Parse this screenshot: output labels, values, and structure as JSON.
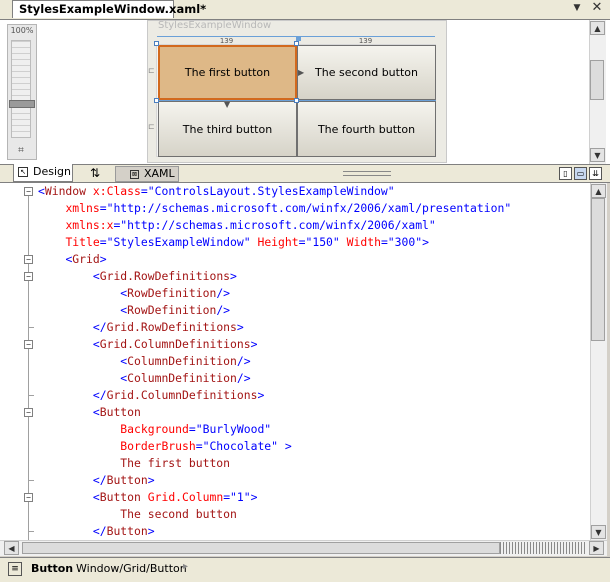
{
  "document_tab": {
    "title": "StylesExampleWindow.xaml*"
  },
  "tab_controls": {
    "menu_icon": "▼",
    "close_icon": "✕"
  },
  "design": {
    "zoom_label": "100%",
    "window_title": "StylesExampleWindow",
    "column_widths": [
      "139",
      "139"
    ],
    "row_marker_glyphs": [
      "⊏",
      "⊏"
    ],
    "buttons": [
      {
        "label": "The first button",
        "background": "#deb887",
        "border": "#d2691e",
        "selected": true
      },
      {
        "label": "The second button"
      },
      {
        "label": "The third button"
      },
      {
        "label": "The fourth button"
      }
    ]
  },
  "view_tabs": {
    "design_label": "Design",
    "swap_glyph": "⇅",
    "xaml_label": "XAML"
  },
  "code_lines": [
    [
      [
        "b",
        "<"
      ],
      [
        "m",
        "Window"
      ],
      [
        "r",
        " x:Class"
      ],
      [
        "b",
        "=\"ControlsLayout.StylesExampleWindow\""
      ]
    ],
    [
      [
        "k",
        "    "
      ],
      [
        "r",
        "xmlns"
      ],
      [
        "b",
        "=\"http://schemas.microsoft.com/winfx/2006/xaml/presentation\""
      ]
    ],
    [
      [
        "k",
        "    "
      ],
      [
        "r",
        "xmlns:x"
      ],
      [
        "b",
        "=\"http://schemas.microsoft.com/winfx/2006/xaml\""
      ]
    ],
    [
      [
        "k",
        "    "
      ],
      [
        "r",
        "Title"
      ],
      [
        "b",
        "=\"StylesExampleWindow\""
      ],
      [
        "r",
        " Height"
      ],
      [
        "b",
        "=\"150\""
      ],
      [
        "r",
        " Width"
      ],
      [
        "b",
        "=\"300\">"
      ]
    ],
    [
      [
        "k",
        "    "
      ],
      [
        "b",
        "<"
      ],
      [
        "m",
        "Grid"
      ],
      [
        "b",
        ">"
      ]
    ],
    [
      [
        "k",
        "        "
      ],
      [
        "b",
        "<"
      ],
      [
        "m",
        "Grid.RowDefinitions"
      ],
      [
        "b",
        ">"
      ]
    ],
    [
      [
        "k",
        "            "
      ],
      [
        "b",
        "<"
      ],
      [
        "m",
        "RowDefinition"
      ],
      [
        "b",
        "/>"
      ]
    ],
    [
      [
        "k",
        "            "
      ],
      [
        "b",
        "<"
      ],
      [
        "m",
        "RowDefinition"
      ],
      [
        "b",
        "/>"
      ]
    ],
    [
      [
        "k",
        "        "
      ],
      [
        "b",
        "</"
      ],
      [
        "m",
        "Grid.RowDefinitions"
      ],
      [
        "b",
        ">"
      ]
    ],
    [
      [
        "k",
        "        "
      ],
      [
        "b",
        "<"
      ],
      [
        "m",
        "Grid.ColumnDefinitions"
      ],
      [
        "b",
        ">"
      ]
    ],
    [
      [
        "k",
        "            "
      ],
      [
        "b",
        "<"
      ],
      [
        "m",
        "ColumnDefinition"
      ],
      [
        "b",
        "/>"
      ]
    ],
    [
      [
        "k",
        "            "
      ],
      [
        "b",
        "<"
      ],
      [
        "m",
        "ColumnDefinition"
      ],
      [
        "b",
        "/>"
      ]
    ],
    [
      [
        "k",
        "        "
      ],
      [
        "b",
        "</"
      ],
      [
        "m",
        "Grid.ColumnDefinitions"
      ],
      [
        "b",
        ">"
      ]
    ],
    [
      [
        "k",
        "        "
      ],
      [
        "b",
        "<"
      ],
      [
        "m",
        "Button"
      ]
    ],
    [
      [
        "k",
        "            "
      ],
      [
        "r",
        "Background"
      ],
      [
        "b",
        "=\"BurlyWood\""
      ]
    ],
    [
      [
        "k",
        "            "
      ],
      [
        "r",
        "BorderBrush"
      ],
      [
        "b",
        "=\"Chocolate\" >"
      ]
    ],
    [
      [
        "k",
        "            "
      ],
      [
        "m",
        "The first button"
      ]
    ],
    [
      [
        "k",
        "        "
      ],
      [
        "b",
        "</"
      ],
      [
        "m",
        "Button"
      ],
      [
        "b",
        ">"
      ]
    ],
    [
      [
        "k",
        "        "
      ],
      [
        "b",
        "<"
      ],
      [
        "m",
        "Button"
      ],
      [
        "r",
        " Grid.Column"
      ],
      [
        "b",
        "=\"1\">"
      ]
    ],
    [
      [
        "k",
        "            "
      ],
      [
        "m",
        "The second button"
      ]
    ],
    [
      [
        "k",
        "        "
      ],
      [
        "b",
        "</"
      ],
      [
        "m",
        "Button"
      ],
      [
        "b",
        ">"
      ]
    ]
  ],
  "status_bar": {
    "element": "Button",
    "path": "Window/Grid/Button",
    "arrow": "▸"
  },
  "colors": {
    "xml_delimiter": "#0000ff",
    "xml_element": "#a31515",
    "xml_attribute": "#ff0000"
  }
}
